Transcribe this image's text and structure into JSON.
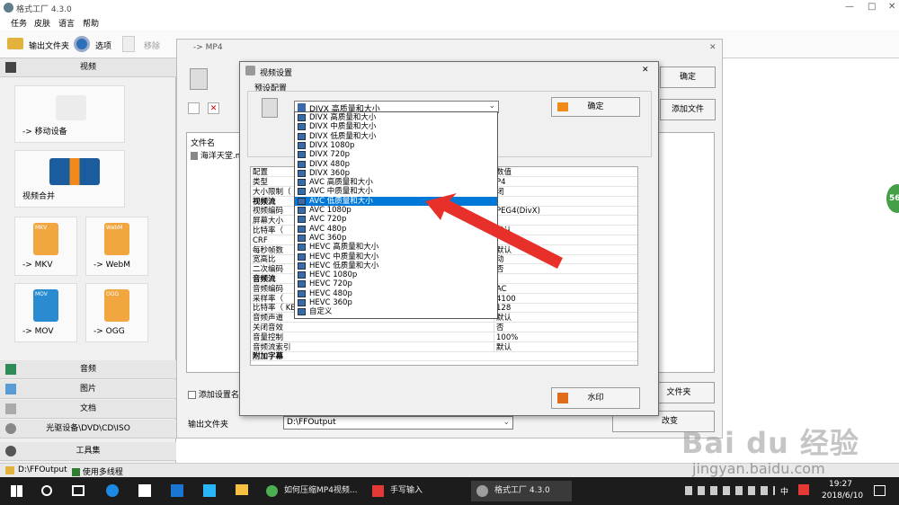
{
  "window": {
    "title": "格式工厂 4.3.0",
    "min": "—",
    "max": "□",
    "close": "✕"
  },
  "menu": [
    "任务",
    "皮肤",
    "语言",
    "帮助"
  ],
  "toolbar": {
    "output_folder": "输出文件夹",
    "options": "选项",
    "remove": "移除"
  },
  "left_pane": {
    "video_category": "视频",
    "tiles": [
      "-> 移动设备",
      "视频合并",
      "-> MKV",
      "-> WebM",
      "-> MOV",
      "-> OGG"
    ],
    "tile_badges": {
      "mkv": "MKV",
      "webm": "WebM",
      "mov": "MOV",
      "ogg": "OGG"
    },
    "categories": [
      "音频",
      "图片",
      "文档",
      "光驱设备\\DVD\\CD\\ISO",
      "工具集"
    ]
  },
  "mp4_dialog": {
    "title": "-> MP4",
    "ok": "确定",
    "add_file": "添加文件",
    "file_name_header": "文件名",
    "file_item": "海洋天堂.m",
    "add_setting_name": "添加设置名称",
    "add_folder": "文件夹",
    "output_folder_label": "输出文件夹",
    "output_path": "D:\\FFOutput",
    "change": "改变"
  },
  "video_settings": {
    "title": "视频设置",
    "close": "✕",
    "preset_label": "预设配置",
    "selected_preset": "DIVX 高质量和大小",
    "ok": "确定",
    "watermark": "水印",
    "grid_headers": {
      "config": "配置",
      "value": "数值"
    },
    "rows": [
      {
        "k": "类型",
        "v": "P4"
      },
      {
        "k": "大小限制（",
        "v": "闭"
      },
      {
        "k": "视频流",
        "v": "",
        "section": true
      },
      {
        "k": "视频编码",
        "v": "PEG4(DivX)"
      },
      {
        "k": "屏幕大小",
        "v": ""
      },
      {
        "k": "比特率（",
        "v": "默认"
      },
      {
        "k": "CRF",
        "v": ""
      },
      {
        "k": "每秒帧数",
        "v": "默认"
      },
      {
        "k": "宽高比",
        "v": "动"
      },
      {
        "k": "二次编码",
        "v": "否"
      },
      {
        "k": "音频流",
        "v": "",
        "section": true
      },
      {
        "k": "音频编码",
        "v": "AC"
      },
      {
        "k": "采样率（",
        "v": "4100"
      },
      {
        "k": "比特率（ KB/秒）",
        "v": "128"
      },
      {
        "k": "音频声道",
        "v": "默认"
      },
      {
        "k": "关闭音效",
        "v": "否"
      },
      {
        "k": "音量控制",
        "v": "100%"
      },
      {
        "k": "音频流索引",
        "v": "默认"
      },
      {
        "k": "附加字幕",
        "v": "",
        "section": true
      }
    ],
    "dropdown_options": [
      "DIVX 高质量和大小",
      "DIVX 中质量和大小",
      "DIVX 低质量和大小",
      "DIVX 1080p",
      "DIVX 720p",
      "DIVX 480p",
      "DIVX 360p",
      "AVC 高质量和大小",
      "AVC 中质量和大小",
      "AVC 低质量和大小",
      "AVC 1080p",
      "AVC 720p",
      "AVC 480p",
      "AVC 360p",
      "HEVC 高质量和大小",
      "HEVC 中质量和大小",
      "HEVC 低质量和大小",
      "HEVC 1080p",
      "HEVC 720p",
      "HEVC 480p",
      "HEVC 360p",
      "自定义"
    ],
    "highlighted_index": 9
  },
  "status_bar": {
    "path": "D:\\FFOutput",
    "multithread": "使用多线程"
  },
  "taskbar": {
    "items": [
      "如何压缩MP4视频...",
      "手写输入",
      "格式工厂 4.3.0"
    ],
    "ime": "中",
    "time": "19:27",
    "date": "2018/6/10"
  },
  "overlay": {
    "badge": "56",
    "watermark": "Bai du 经验",
    "watermark_url": "jingyan.baidu.com"
  },
  "colors": {
    "highlight": "#0078d7",
    "arrow": "#e8302a",
    "taskbar": "#1c1c1c"
  }
}
